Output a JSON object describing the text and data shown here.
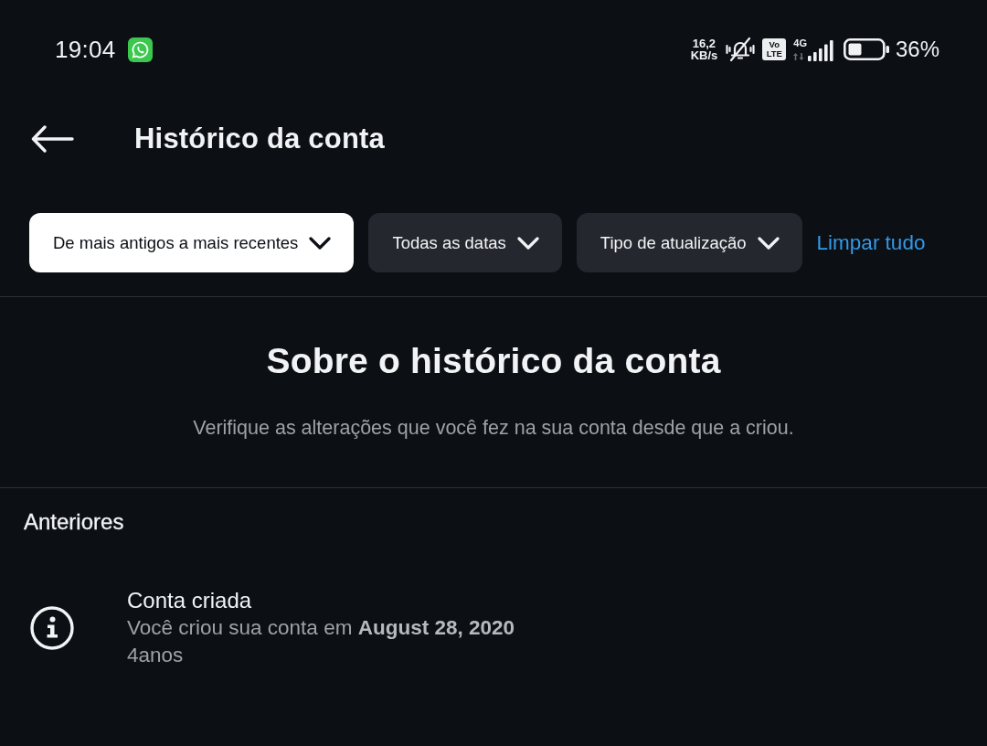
{
  "status_bar": {
    "time": "19:04",
    "speed_value": "16,2",
    "speed_unit": "KB/s",
    "volte_top": "Vo",
    "volte_bottom": "LTE",
    "network_type": "4G",
    "battery_percent": "36%"
  },
  "header": {
    "title": "Histórico da conta"
  },
  "filters": [
    {
      "label": "De mais antigos a mais recentes",
      "selected": true
    },
    {
      "label": "Todas as datas",
      "selected": false
    },
    {
      "label": "Tipo de atualização",
      "selected": false
    }
  ],
  "clear_link": "Limpar tudo",
  "about": {
    "title": "Sobre o histórico da conta",
    "description": "Verifique as alterações que você fez na sua conta desde que a criou."
  },
  "sections": [
    {
      "title": "Anteriores",
      "items": [
        {
          "title": "Conta criada",
          "description": "Você criou sua conta em **August 28, 2020**",
          "age": "4anos"
        }
      ]
    }
  ]
}
